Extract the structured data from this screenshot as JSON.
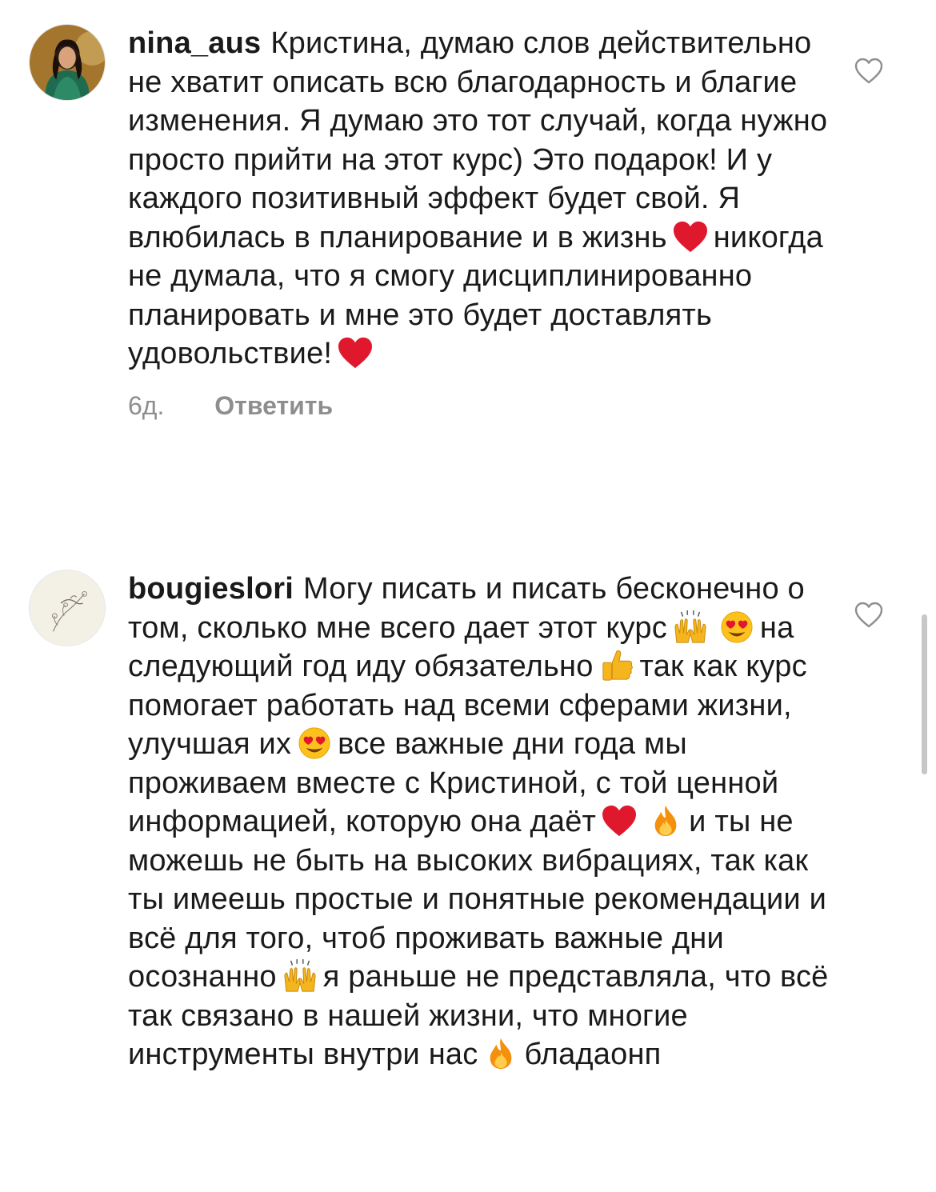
{
  "comments": [
    {
      "username": "nina_aus",
      "avatar": "woman-portrait-avatar",
      "segments": [
        "Кристина, думаю слов действительно не хватит описать всю благодарность и благие изменения. Я думаю это тот случай, когда нужно просто прийти на этот курс) Это подарок! И у каждого позитивный эффект будет свой. Я влюбилась в планирование и в жизнь",
        "никогда не думала, что я смогу дисциплинированно планировать и мне это будет доставлять удовольствие!"
      ],
      "time": "6д.",
      "reply_label": "Ответить"
    },
    {
      "username": "bougieslori",
      "avatar": "floral-logo-avatar",
      "segments": [
        "Могу писать и писать бесконечно о том, сколько мне всего дает этот курс",
        "на следующий год иду обязательно",
        "так как курс помогает работать над всеми сферами жизни, улучшая их",
        "все важные дни года мы проживаем вместе с Кристиной, с той ценной информацией, которую она даёт",
        "и ты не можешь не быть на высоких вибрациях, так как ты имеешь простые и понятные рекомендации и всё для того, чтоб проживать важные дни осознанно",
        "я раньше не представляла, что всё так связано в нашей жизни, что многие инструменты внутри нас",
        "бладаонп"
      ]
    }
  ],
  "icons": {
    "like": "heart-outline-icon",
    "heart_emoji": "red-heart-emoji",
    "raising_hands_emoji": "raising-hands-emoji",
    "heart_eyes_emoji": "heart-eyes-emoji",
    "thumbs_up_emoji": "thumbs-up-emoji",
    "fire_emoji": "fire-emoji"
  },
  "colors": {
    "text": "#1a1a1a",
    "meta": "#8e8e8e",
    "heart": "#e0182d",
    "like_outline": "#8e8e8e"
  }
}
